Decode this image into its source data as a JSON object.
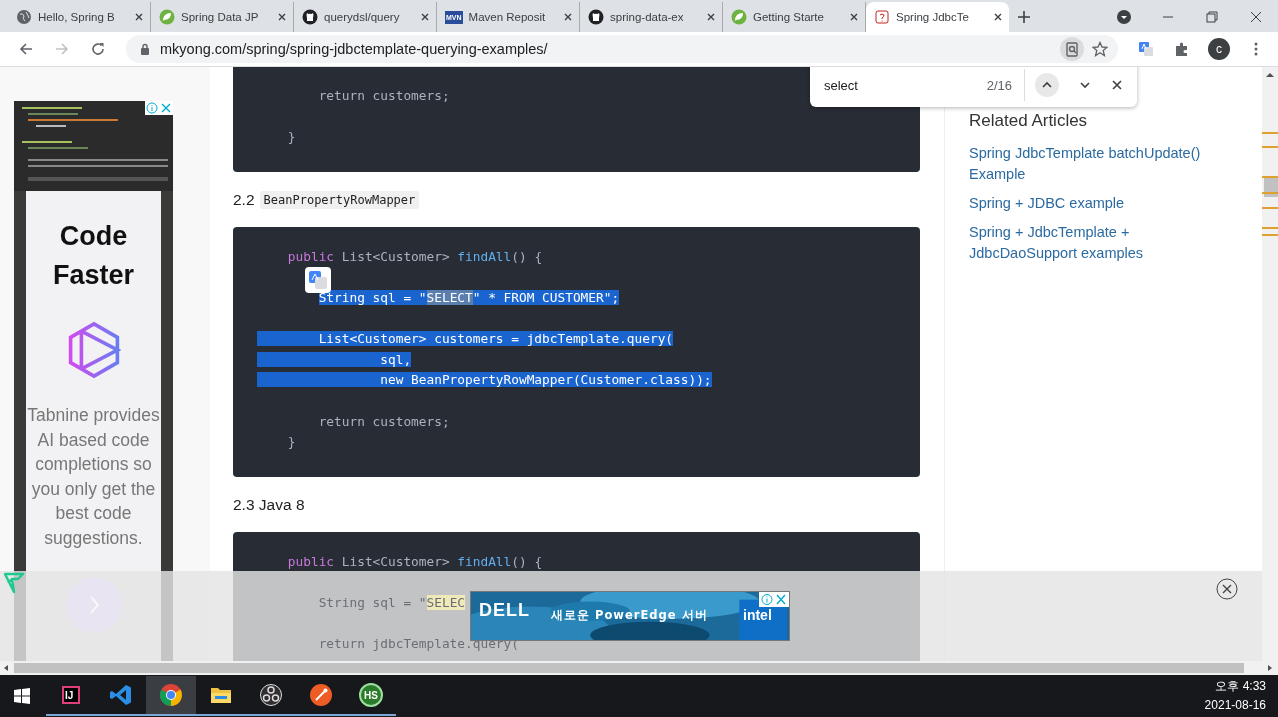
{
  "tabs": [
    {
      "title": "Hello, Spring B",
      "kind": "globe",
      "selected": false
    },
    {
      "title": "Spring Data JP",
      "kind": "leaf",
      "selected": false
    },
    {
      "title": "querydsl/query",
      "kind": "github",
      "selected": false
    },
    {
      "title": "Maven Reposit",
      "kind": "maven",
      "icon_text": "MVN",
      "selected": false
    },
    {
      "title": "spring-data-ex",
      "kind": "github",
      "selected": false
    },
    {
      "title": "Getting Starte",
      "kind": "leaf",
      "selected": false
    },
    {
      "title": "Spring JdbcTe",
      "kind": "page",
      "selected": true
    }
  ],
  "address_bar": {
    "url": "mkyong.com/spring/spring-jdbctemplate-querying-examples/",
    "profile_letter": "c"
  },
  "find_bar": {
    "query": "select",
    "count": "2/16"
  },
  "left_ad": {
    "title": "Code Faster",
    "text": "Tabnine provides AI based code completions so you only get the best code suggestions."
  },
  "article": [
    {
      "kind": "code",
      "lines": [
        {
          "gap_before": false,
          "indent_selected": false,
          "segments": [
            {
              "text": "        return customers;",
              "kind": "plain",
              "selected": false
            }
          ]
        },
        {
          "gap_before": true,
          "indent_selected": false,
          "segments": [
            {
              "text": "    }",
              "kind": "plain",
              "selected": false
            }
          ]
        }
      ]
    },
    {
      "kind": "heading",
      "text": "2.2",
      "code": "BeanPropertyRowMapper"
    },
    {
      "kind": "code",
      "lines": [
        {
          "gap_before": false,
          "indent_selected": false,
          "segments": [
            {
              "text": "    public",
              "kind": "keyword",
              "selected": false
            },
            {
              "text": " List<Customer> ",
              "kind": "plain",
              "selected": false
            },
            {
              "text": "findAll",
              "kind": "method",
              "selected": false
            },
            {
              "text": "() {",
              "kind": "plain",
              "selected": false
            }
          ]
        },
        {
          "gap_before": true,
          "indent_selected": false,
          "segments": [
            {
              "text": "        String sql = \"",
              "kind": "plain",
              "selected": true
            },
            {
              "text": "SELECT",
              "kind": "match",
              "selected": true
            },
            {
              "text": "\" * FROM CUSTOMER\";",
              "kind": "plain",
              "selected": true
            }
          ]
        },
        {
          "gap_before": true,
          "indent_selected": true,
          "segments": [
            {
              "text": "        List<Customer> customers = jdbcTemplate.query(",
              "kind": "plain",
              "selected": true
            }
          ]
        },
        {
          "gap_before": false,
          "indent_selected": true,
          "segments": [
            {
              "text": "                sql,",
              "kind": "plain",
              "selected": true
            }
          ]
        },
        {
          "gap_before": false,
          "indent_selected": true,
          "segments": [
            {
              "text": "                new BeanPropertyRowMapper(Customer.class));",
              "kind": "plain",
              "selected": true
            }
          ]
        },
        {
          "gap_before": true,
          "indent_selected": false,
          "segments": [
            {
              "text": "        return customers;",
              "kind": "plain",
              "selected": false
            }
          ]
        },
        {
          "gap_before": false,
          "indent_selected": false,
          "segments": [
            {
              "text": "    }",
              "kind": "plain",
              "selected": false
            }
          ]
        }
      ]
    },
    {
      "kind": "heading",
      "text": "2.3 Java 8"
    },
    {
      "kind": "code",
      "lines": [
        {
          "gap_before": false,
          "indent_selected": false,
          "segments": [
            {
              "text": "    public",
              "kind": "keyword",
              "selected": false
            },
            {
              "text": " List<Customer> ",
              "kind": "plain",
              "selected": false
            },
            {
              "text": "findAll",
              "kind": "method",
              "selected": false
            },
            {
              "text": "() {",
              "kind": "plain",
              "selected": false
            }
          ]
        },
        {
          "gap_before": true,
          "indent_selected": false,
          "segments": [
            {
              "text": "        String sql = \"",
              "kind": "plain",
              "selected": false
            },
            {
              "text": "SELEC",
              "kind": "match",
              "selected": false
            }
          ]
        },
        {
          "gap_before": true,
          "indent_selected": false,
          "segments": [
            {
              "text": "        return jdbcTemplate.query(",
              "kind": "plain",
              "selected": false
            }
          ]
        }
      ]
    }
  ],
  "sidebar": {
    "heading": "Related Articles",
    "links": [
      "Spring JdbcTemplate batchUpdate() Example",
      "Spring + JDBC example",
      "Spring + JdbcTemplate + JdbcDaoSupport examples"
    ]
  },
  "bottom_ad": {
    "logo": "DELL",
    "text": "새로운 PowerEdge 서버",
    "brand": "intel"
  },
  "taskbar": {
    "apps": [
      {
        "kind": "intellij",
        "icon_text": "IJ",
        "selected": false
      },
      {
        "kind": "vscode",
        "selected": false
      },
      {
        "kind": "chrome",
        "selected": true
      },
      {
        "kind": "folder",
        "selected": false
      },
      {
        "kind": "obs",
        "selected": false
      },
      {
        "kind": "postman",
        "selected": false
      },
      {
        "kind": "hs",
        "icon_text": "HS",
        "selected": false
      }
    ],
    "time": "오후 4:33",
    "date": "2021-08-16"
  }
}
